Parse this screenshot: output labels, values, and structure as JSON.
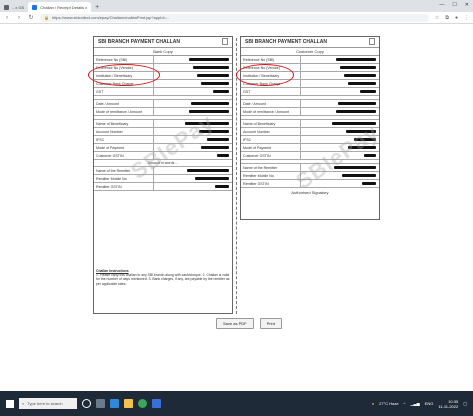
{
  "browser": {
    "tabs": [
      {
        "label": "...x GS"
      },
      {
        "label": "Challan / Receipt Details x"
      }
    ],
    "new_tab": "+",
    "window_controls": [
      "—",
      "☐",
      "✕"
    ],
    "url": "https://www.sbicollect.com/epay/Challan/challanPrint.jsp?appId=..."
  },
  "challans": {
    "left": {
      "title": "SBI BRANCH PAYMENT CHALLAN",
      "subtitle": "Bank Copy",
      "rows": [
        {
          "label": "Reference No (SBI)",
          "redact": 40
        },
        {
          "label": "Reference No (Vendor)",
          "redact": 36
        },
        {
          "label": "Institution / Beneficiary",
          "redact": 32
        },
        {
          "label": "Customer Bank Charge",
          "redact": 28
        },
        {
          "label": "GST",
          "redact": 16
        }
      ],
      "rows2": [
        {
          "label": "Date / Amount",
          "redact": 38
        },
        {
          "label": "Mode of remittance / Amount",
          "redact": 40
        }
      ],
      "rows3": [
        {
          "label": "Name of Beneficiary",
          "redact": 44
        },
        {
          "label": "Account Number",
          "redact": 30
        },
        {
          "label": "IFSC",
          "redact": 22
        },
        {
          "label": "Mode of Payment",
          "redact": 28
        },
        {
          "label": "Customer GSTIN",
          "redact": 12
        }
      ],
      "amount_words": "Amount in words ...",
      "rows4": [
        {
          "label": "Name of the Remitter",
          "redact": 42
        },
        {
          "label": "Remitter Mobile No",
          "redact": 34
        },
        {
          "label": "Remitter GSTIN",
          "redact": 14
        }
      ],
      "notes_heading": "Challan Instructions",
      "notes": "1. Please carry this challan to any SBI branch along with cash/cheque. 2. Challan is valid for the number of days mentioned. 3. Bank charges, if any, are payable by the remitter as per applicable rates."
    },
    "right": {
      "title": "SBI BRANCH PAYMENT CHALLAN",
      "subtitle": "Customer Copy",
      "rows": [
        {
          "label": "Reference No (SBI)",
          "redact": 40
        },
        {
          "label": "Reference No (Vendor)",
          "redact": 36
        },
        {
          "label": "Institution / Beneficiary",
          "redact": 32
        },
        {
          "label": "Customer Bank Charge",
          "redact": 28
        },
        {
          "label": "GST",
          "redact": 16
        }
      ],
      "rows2": [
        {
          "label": "Date / Amount",
          "redact": 38
        },
        {
          "label": "Mode of remittance / Amount",
          "redact": 40
        }
      ],
      "rows3": [
        {
          "label": "Name of Beneficiary",
          "redact": 44
        },
        {
          "label": "Account Number",
          "redact": 30
        },
        {
          "label": "IFSC",
          "redact": 22
        },
        {
          "label": "Mode of Payment",
          "redact": 28
        },
        {
          "label": "Customer GSTIN",
          "redact": 12
        }
      ],
      "rows4": [
        {
          "label": "Name of the Remitter",
          "redact": 42
        },
        {
          "label": "Remitter Mobile No",
          "redact": 34
        },
        {
          "label": "Remitter GSTIN",
          "redact": 14
        }
      ],
      "auth": "Authorised Signatory"
    }
  },
  "watermark": "SBIePay",
  "buttons": {
    "save": "Save as PDF",
    "print": "Print"
  },
  "taskbar": {
    "search_placeholder": "Type here to search",
    "weather": "27°C Haze",
    "lang": "ENG",
    "time": "10:35",
    "date": "11-11-2022"
  },
  "colors": {
    "highlight_circle": "#dd1111",
    "taskbar": "#1f2a38"
  }
}
